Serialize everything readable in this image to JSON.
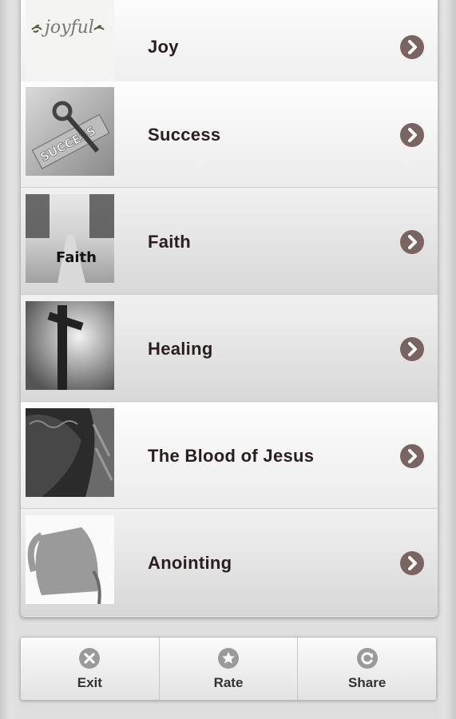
{
  "items": [
    {
      "label": "Joy",
      "image": "joyful-script-image"
    },
    {
      "label": "Success",
      "image": "success-key-image"
    },
    {
      "label": "Faith",
      "image": "faith-road-image"
    },
    {
      "label": "Healing",
      "image": "cross-sky-image"
    },
    {
      "label": "The Blood of Jesus",
      "image": "crown-of-thorns-image"
    },
    {
      "label": "Anointing",
      "image": "oil-jug-image"
    }
  ],
  "joy_image_text": "joyful",
  "success_image_text": "SUCCESS",
  "faith_image_text": "Faith",
  "toolbar": {
    "exit_label": "Exit",
    "rate_label": "Rate",
    "share_label": "Share"
  },
  "colors": {
    "chevron": "#7a6461",
    "toolbar_icon": "#9a9a9a",
    "label_text": "#2b1e1e"
  },
  "icons": [
    "chevron-right-icon",
    "close-circle-icon",
    "star-circle-icon",
    "refresh-circle-icon"
  ]
}
